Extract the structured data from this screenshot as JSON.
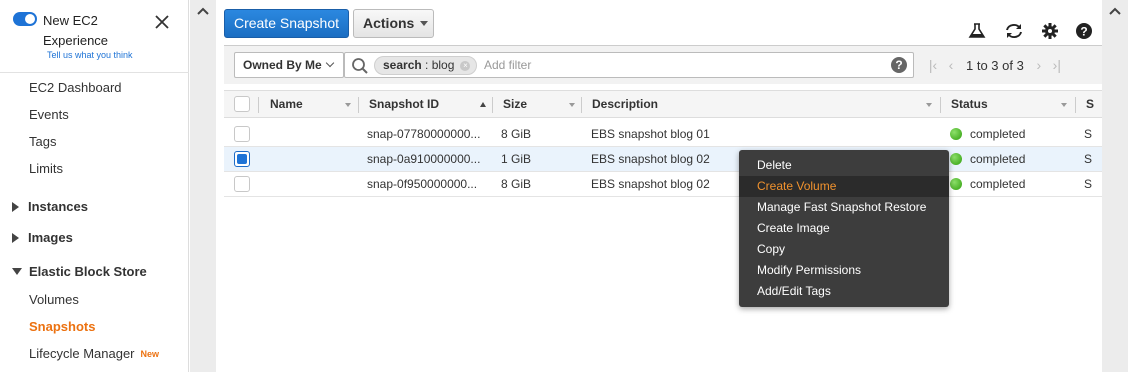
{
  "sidebar": {
    "experience_title": "New EC2 Experience",
    "experience_link": "Tell us what you think",
    "items": [
      {
        "label": "EC2 Dashboard"
      },
      {
        "label": "Events"
      },
      {
        "label": "Tags"
      },
      {
        "label": "Limits"
      }
    ],
    "groups": [
      {
        "label": "Instances",
        "expanded": false
      },
      {
        "label": "Images",
        "expanded": false
      },
      {
        "label": "Elastic Block Store",
        "expanded": true
      }
    ],
    "ebs_items": [
      {
        "label": "Volumes"
      },
      {
        "label": "Snapshots",
        "active": true
      },
      {
        "label": "Lifecycle Manager",
        "badge": "New"
      }
    ]
  },
  "toolbar": {
    "create_label": "Create Snapshot",
    "actions_label": "Actions",
    "icons": [
      "flask-icon",
      "refresh-icon",
      "gear-icon",
      "help-icon"
    ]
  },
  "filter": {
    "owner_label": "Owned By Me",
    "chip_key": "search",
    "chip_value": "blog",
    "placeholder": "Add filter",
    "pager_text": "1 to 3 of 3"
  },
  "table": {
    "columns": [
      "Name",
      "Snapshot ID",
      "Size",
      "Description",
      "Status",
      "S"
    ],
    "rows": [
      {
        "name": "",
        "id": "snap-07780000000...",
        "size": "8 GiB",
        "description": "EBS snapshot blog 01",
        "status": "completed",
        "extra": "S",
        "selected": false
      },
      {
        "name": "",
        "id": "snap-0a910000000...",
        "size": "1 GiB",
        "description": "EBS snapshot blog 02",
        "status": "completed",
        "extra": "S",
        "selected": true
      },
      {
        "name": "",
        "id": "snap-0f950000000...",
        "size": "8 GiB",
        "description": "EBS snapshot blog 02",
        "status": "completed",
        "extra": "S",
        "selected": false
      }
    ]
  },
  "context_menu": {
    "items": [
      {
        "label": "Delete"
      },
      {
        "label": "Create Volume",
        "highlighted": true
      },
      {
        "label": "Manage Fast Snapshot Restore"
      },
      {
        "label": "Create Image"
      },
      {
        "label": "Copy"
      },
      {
        "label": "Modify Permissions"
      },
      {
        "label": "Add/Edit Tags"
      }
    ]
  },
  "colors": {
    "primary": "#1e73d6",
    "active_nav": "#ec7211",
    "status_ok": "#3ca712",
    "menu_bg": "#3d3d3d",
    "menu_highlight_text": "#f0922e"
  }
}
